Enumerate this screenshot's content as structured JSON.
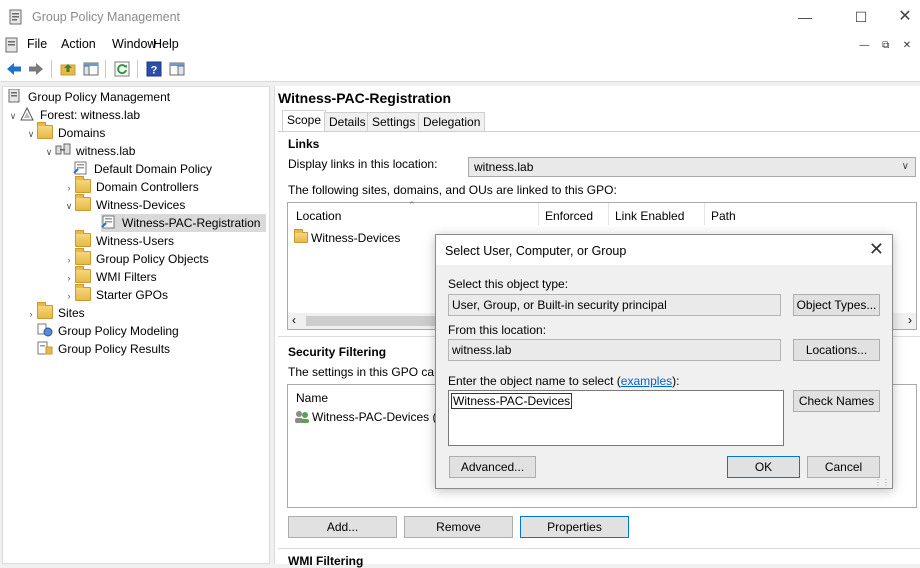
{
  "window": {
    "title": "Group Policy Management"
  },
  "menu": [
    "File",
    "Action",
    "Window",
    "Help"
  ],
  "tree": {
    "root": "Group Policy Management",
    "forest": "Forest: witness.lab",
    "domains": "Domains",
    "domain": "witness.lab",
    "default_policy": "Default Domain Policy",
    "domain_controllers": "Domain Controllers",
    "witness_devices": "Witness-Devices",
    "selected_gpo": "Witness-PAC-Registration",
    "witness_users": "Witness-Users",
    "gpo_objects": "Group Policy Objects",
    "wmi_filters": "WMI Filters",
    "starter_gpos": "Starter GPOs",
    "sites": "Sites",
    "modeling": "Group Policy Modeling",
    "results": "Group Policy Results"
  },
  "gpo": {
    "title": "Witness-PAC-Registration",
    "tabs": [
      "Scope",
      "Details",
      "Settings",
      "Delegation"
    ],
    "links": {
      "heading": "Links",
      "display_label": "Display links in this location:",
      "location_value": "witness.lab",
      "linked_text": "The following sites, domains, and OUs are linked to this GPO:",
      "columns": [
        "Location",
        "Enforced",
        "Link Enabled",
        "Path"
      ],
      "rows": [
        {
          "location": "Witness-Devices"
        }
      ]
    },
    "security": {
      "heading": "Security Filtering",
      "text": "The settings in this GPO can on",
      "column": "Name",
      "row": "Witness-PAC-Devices (WIT",
      "buttons": {
        "add": "Add...",
        "remove": "Remove",
        "properties": "Properties"
      }
    },
    "wmi_heading": "WMI Filtering"
  },
  "dialog": {
    "title": "Select User, Computer, or Group",
    "object_type_label": "Select this object type:",
    "object_type_value": "User, Group, or Built-in security principal",
    "object_types_btn": "Object Types...",
    "location_label": "From this location:",
    "location_value": "witness.lab",
    "locations_btn": "Locations...",
    "enter_label": "Enter the object name to select (",
    "examples_link": "examples",
    "enter_label_end": "):",
    "name_value": "Witness-PAC-Devices",
    "check_names_btn": "Check Names",
    "advanced_btn": "Advanced...",
    "ok_btn": "OK",
    "cancel_btn": "Cancel"
  },
  "colors": {
    "accent": "#0078d7",
    "selection": "#d9d9d9",
    "link": "#0066cc"
  }
}
